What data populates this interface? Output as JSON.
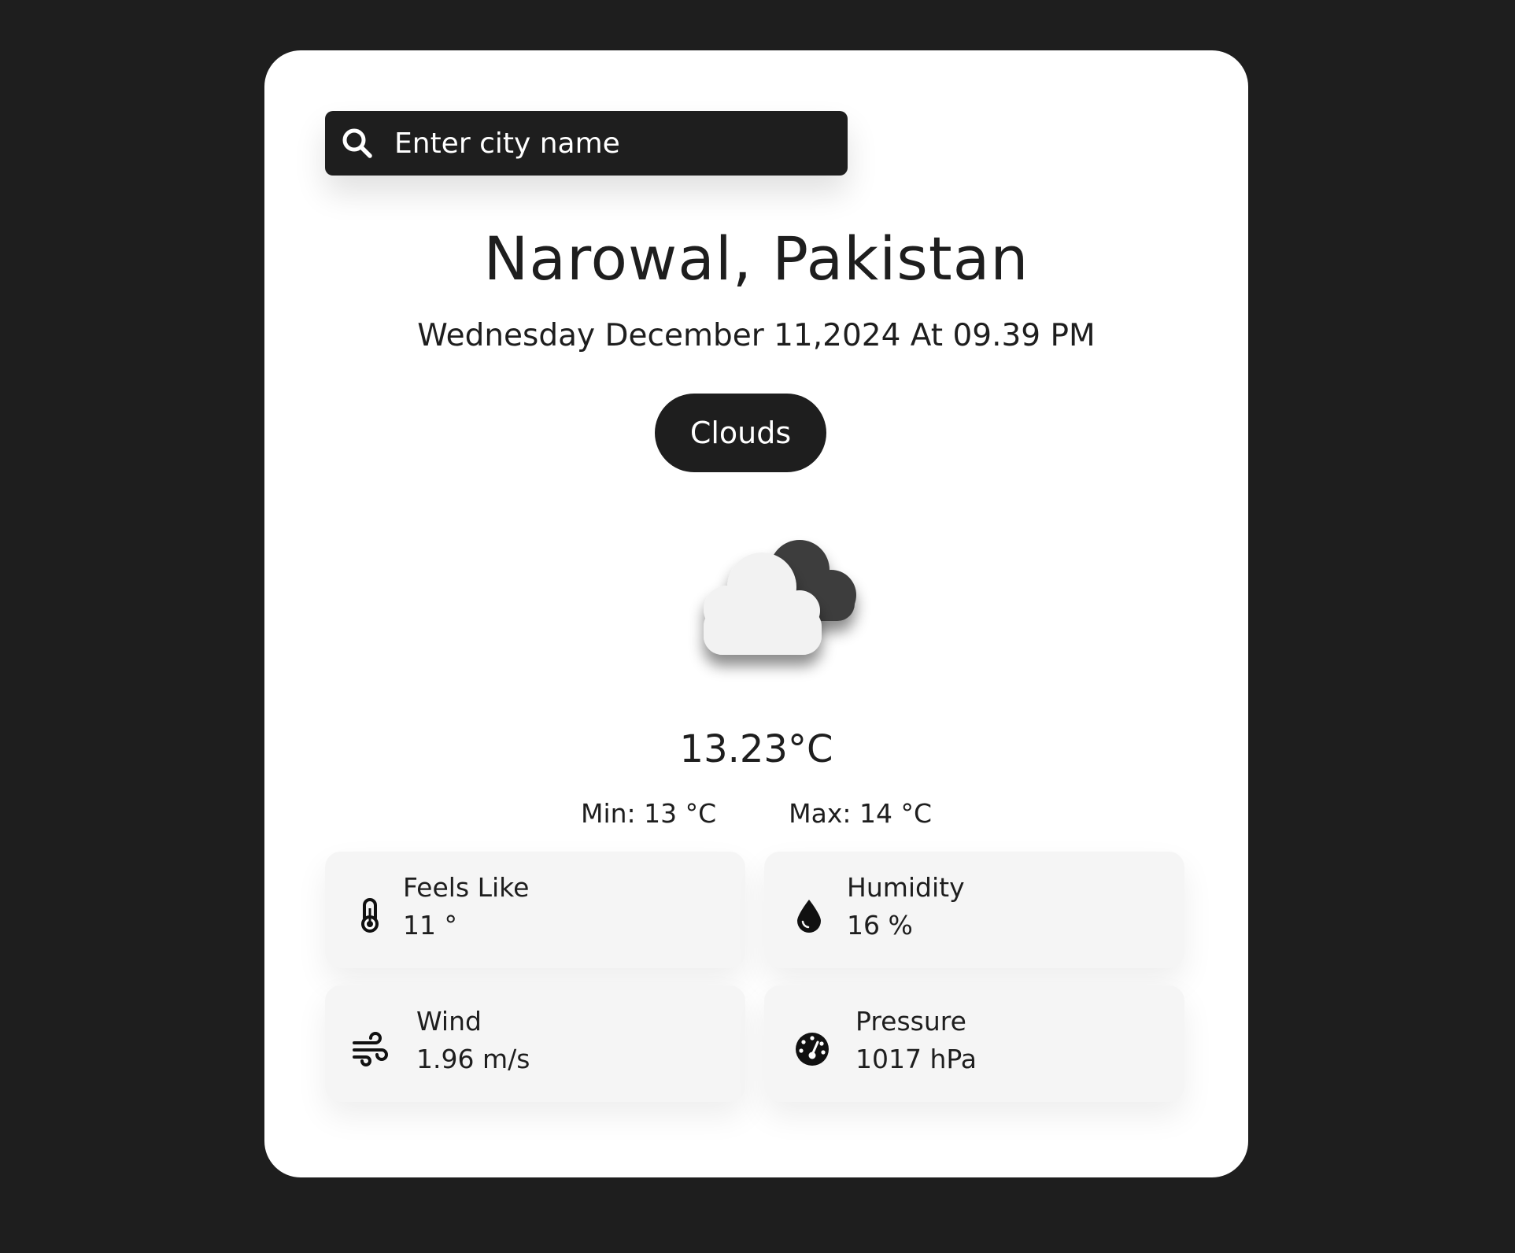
{
  "search": {
    "placeholder": "Enter city name",
    "icon": "search-icon"
  },
  "location": {
    "city_country": "Narowal, Pakistan"
  },
  "datetime": "Wednesday December 11,2024 At 09.39 PM",
  "condition": {
    "label": "Clouds",
    "icon": "clouds-icon"
  },
  "temperature": {
    "current": "13.23°C",
    "min": "Min: 13 °C",
    "max": "Max: 14 °C"
  },
  "stats": [
    {
      "label": "Feels Like",
      "value": "11 °",
      "icon": "thermometer-icon"
    },
    {
      "label": "Humidity",
      "value": "16 %",
      "icon": "water-drop-icon"
    },
    {
      "label": "Wind",
      "value": "1.96 m/s",
      "icon": "wind-icon"
    },
    {
      "label": "Pressure",
      "value": "1017 hPa",
      "icon": "gauge-icon"
    }
  ],
  "colors": {
    "background": "#1e1e1e",
    "card": "#ffffff",
    "tile": "#f5f5f5",
    "text": "#1e1e1e"
  }
}
